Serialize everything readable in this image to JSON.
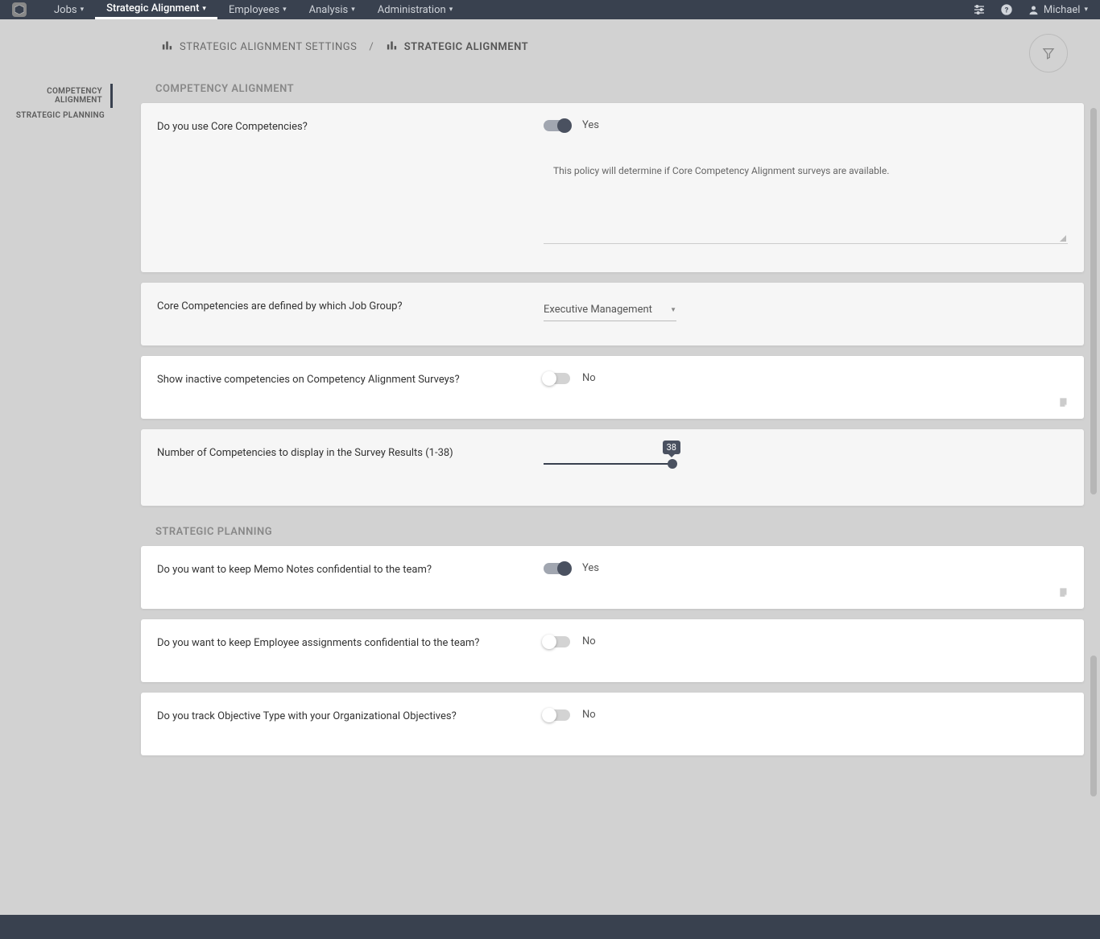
{
  "nav": {
    "items": [
      "Jobs",
      "Strategic Alignment",
      "Employees",
      "Analysis",
      "Administration"
    ],
    "active": 1
  },
  "user": {
    "name": "Michael"
  },
  "breadcrumb": {
    "item1": "STRATEGIC ALIGNMENT SETTINGS",
    "item2": "STRATEGIC ALIGNMENT"
  },
  "leftnav": {
    "items": [
      "COMPETENCY ALIGNMENT",
      "STRATEGIC PLANNING"
    ],
    "active": 0
  },
  "sections": {
    "comp": {
      "title": "COMPETENCY ALIGNMENT",
      "q1": {
        "label": "Do you use Core Competencies?",
        "value": "Yes",
        "desc": "This policy will determine if Core Competency Alignment surveys are available."
      },
      "q2": {
        "label": "Core Competencies are defined by which Job Group?",
        "value": "Executive Management"
      },
      "q3": {
        "label": "Show inactive competencies on Competency Alignment Surveys?",
        "value": "No"
      },
      "q4": {
        "label": "Number of Competencies to display in the Survey Results (1-38)",
        "value": "38"
      }
    },
    "plan": {
      "title": "STRATEGIC PLANNING",
      "q1": {
        "label": "Do you want to keep Memo Notes confidential to the team?",
        "value": "Yes"
      },
      "q2": {
        "label": "Do you want to keep Employee assignments confidential to the team?",
        "value": "No"
      },
      "q3": {
        "label": "Do you track Objective Type with your Organizational Objectives?",
        "value": "No"
      }
    }
  }
}
